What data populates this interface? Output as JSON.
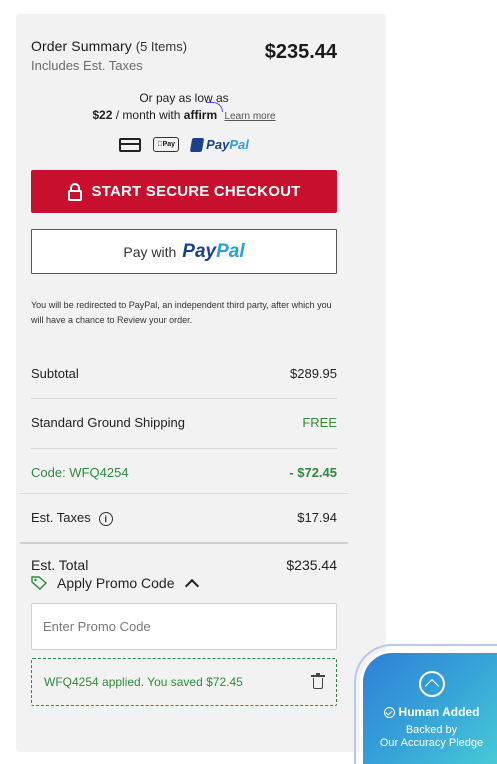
{
  "summary": {
    "title": "Order Summary",
    "items": "(5 Items)",
    "subtitle": "Includes Est. Taxes",
    "total": "$235.44"
  },
  "affirm": {
    "line1": "Or pay as low as",
    "amount": "$22",
    "per": "/ month with",
    "brand": "affirm",
    "learn_more": "Learn more"
  },
  "payment_icons": {
    "apple_pay": "Pay",
    "paypal_a": "Pay",
    "paypal_b": "Pal"
  },
  "checkout_button": {
    "label": "START SECURE CHECKOUT"
  },
  "paypal_button": {
    "prefix": "Pay with",
    "brand_a": "Pay",
    "brand_b": "Pal"
  },
  "redirect_note": "You will be redirected to PayPal, an independent third party, after which you will have a chance to Review your order.",
  "lines": {
    "subtotal_label": "Subtotal",
    "subtotal_value": "$289.95",
    "shipping_label": "Standard Ground Shipping",
    "shipping_value": "FREE",
    "code_label": "Code: WFQ4254",
    "code_value": "- $72.45",
    "taxes_label": "Est. Taxes",
    "taxes_value": "$17.94",
    "total_label": "Est. Total",
    "total_value": "$235.44"
  },
  "promo": {
    "toggle_label": "Apply Promo Code",
    "placeholder": "Enter Promo Code",
    "applied_message": "WFQ4254 applied. You saved $72.45"
  },
  "badge": {
    "title": "Human Added",
    "line1": "Backed by",
    "line2": "Our Accuracy Pledge"
  },
  "colors": {
    "checkout_red": "#c8102e",
    "discount_green": "#2e8b3a",
    "paypal_dark": "#1d3f8f",
    "paypal_light": "#2a9fe0",
    "badge_blue": "#36a6d8"
  }
}
